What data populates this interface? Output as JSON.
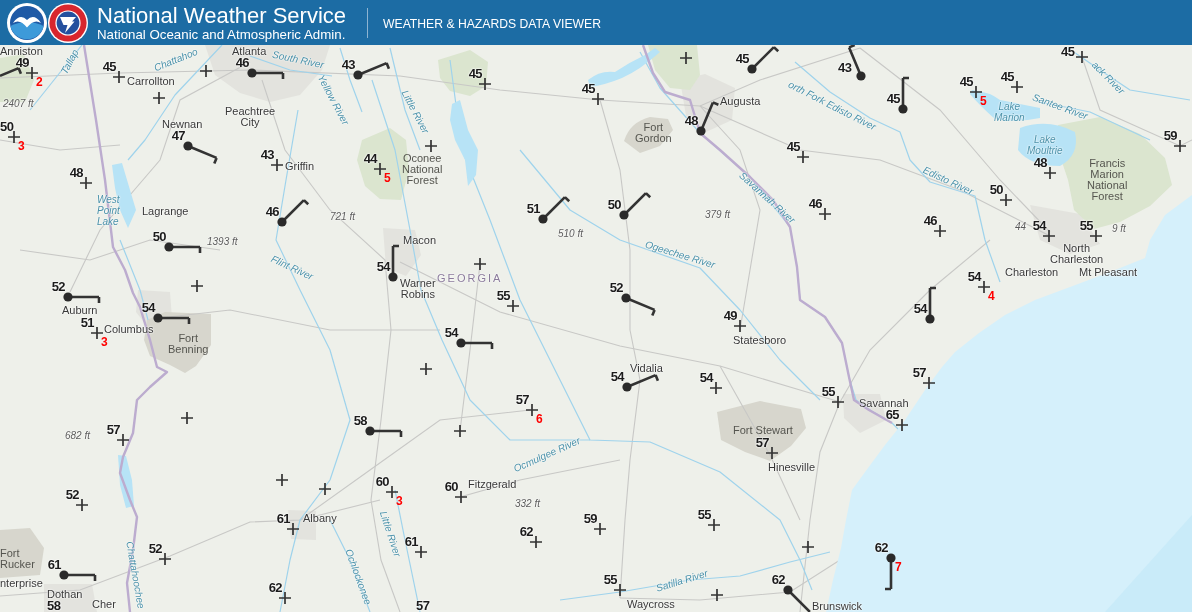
{
  "header": {
    "title": "National Weather Service",
    "subtitle": "National Oceanic and Atmospheric Admin.",
    "app_title": "WEATHER & HAZARDS DATA VIEWER"
  },
  "map": {
    "places": [
      {
        "text": "Anniston",
        "kind": "city"
      },
      {
        "text": "Tallap",
        "kind": "water"
      },
      {
        "text": "Chattahoo",
        "kind": "water"
      },
      {
        "text": "Atlanta",
        "kind": "city"
      },
      {
        "text": "South River",
        "kind": "water"
      },
      {
        "text": "Carrollton",
        "kind": "city"
      },
      {
        "text": "ack River",
        "kind": "water"
      },
      {
        "text": "2407 ft",
        "kind": "elevation"
      },
      {
        "text": "Yellow River",
        "kind": "water"
      },
      {
        "text": "Little River",
        "kind": "water"
      },
      {
        "text": "Augusta",
        "kind": "city"
      },
      {
        "text": "orth Fork Edisto River",
        "kind": "water"
      },
      {
        "text": "Lake Marion",
        "kind": "water"
      },
      {
        "text": "Santee River",
        "kind": "water"
      },
      {
        "text": "Newnan",
        "kind": "city"
      },
      {
        "text": "Peachtree City",
        "kind": "city"
      },
      {
        "text": "Fort Gordon",
        "kind": "area"
      },
      {
        "text": "Lake Moultrie",
        "kind": "water"
      },
      {
        "text": "Griffin",
        "kind": "city"
      },
      {
        "text": "Oconee National Forest",
        "kind": "area"
      },
      {
        "text": "Edisto River",
        "kind": "water"
      },
      {
        "text": "Francis Marion National Forest",
        "kind": "area"
      },
      {
        "text": "Savannah River",
        "kind": "water"
      },
      {
        "text": "West Point Lake",
        "kind": "water"
      },
      {
        "text": "Lagrange",
        "kind": "city"
      },
      {
        "text": "721 ft",
        "kind": "elevation"
      },
      {
        "text": "379 ft",
        "kind": "elevation"
      },
      {
        "text": "510 ft",
        "kind": "elevation"
      },
      {
        "text": "44",
        "kind": "elevation"
      },
      {
        "text": "9 ft",
        "kind": "elevation"
      },
      {
        "text": "1393 ft",
        "kind": "elevation"
      },
      {
        "text": "Macon",
        "kind": "city"
      },
      {
        "text": "Ogeechee River",
        "kind": "water"
      },
      {
        "text": "North Charleston",
        "kind": "city"
      },
      {
        "text": "Flint River",
        "kind": "water"
      },
      {
        "text": "GEORGIA",
        "kind": "state"
      },
      {
        "text": "Charleston",
        "kind": "city"
      },
      {
        "text": "Mt Pleasant",
        "kind": "city"
      },
      {
        "text": "Warner Robins",
        "kind": "city"
      },
      {
        "text": "Auburn",
        "kind": "city"
      },
      {
        "text": "Columbus",
        "kind": "city"
      },
      {
        "text": "Fort Benning",
        "kind": "area"
      },
      {
        "text": "Statesboro",
        "kind": "city"
      },
      {
        "text": "Vidalia",
        "kind": "city"
      },
      {
        "text": "Savannah",
        "kind": "city"
      },
      {
        "text": "682 ft",
        "kind": "elevation"
      },
      {
        "text": "Fort Stewart",
        "kind": "area"
      },
      {
        "text": "Ocmulgee River",
        "kind": "water"
      },
      {
        "text": "Hinesville",
        "kind": "city"
      },
      {
        "text": "Fitzgerald",
        "kind": "city"
      },
      {
        "text": "332 ft",
        "kind": "elevation"
      },
      {
        "text": "Albany",
        "kind": "city"
      },
      {
        "text": "Little River",
        "kind": "water"
      },
      {
        "text": "Fort Rucker",
        "kind": "area"
      },
      {
        "text": "nterprise",
        "kind": "city"
      },
      {
        "text": "Chattahoochee",
        "kind": "water"
      },
      {
        "text": "Ochlockonee",
        "kind": "water"
      },
      {
        "text": "Satilla River",
        "kind": "water"
      },
      {
        "text": "Dothan",
        "kind": "city"
      },
      {
        "text": "Cher",
        "kind": "city"
      },
      {
        "text": "Waycross",
        "kind": "city"
      },
      {
        "text": "Brunswick",
        "kind": "city"
      }
    ],
    "stations": [
      {
        "kind": "barb"
      },
      {
        "temperature": "49",
        "kind": "plus",
        "secondary_value": "2"
      },
      {
        "temperature": "45",
        "kind": "plus"
      },
      {
        "kind": "plus"
      },
      {
        "kind": "plus"
      },
      {
        "temperature": "46",
        "kind": "barb"
      },
      {
        "temperature": "43",
        "kind": "barb"
      },
      {
        "temperature": "45",
        "kind": "plus"
      },
      {
        "temperature": "45",
        "kind": "plus"
      },
      {
        "kind": "plus"
      },
      {
        "temperature": "45",
        "kind": "barb"
      },
      {
        "temperature": "43",
        "kind": "barb"
      },
      {
        "temperature": "45",
        "kind": "barb"
      },
      {
        "temperature": "45",
        "kind": "plus",
        "secondary_value": "5"
      },
      {
        "temperature": "45",
        "kind": "plus"
      },
      {
        "temperature": "45",
        "kind": "plus"
      },
      {
        "temperature": "50",
        "kind": "plus",
        "secondary_value": "3"
      },
      {
        "temperature": "48",
        "kind": "plus"
      },
      {
        "temperature": "47",
        "kind": "barb"
      },
      {
        "temperature": "43",
        "kind": "plus"
      },
      {
        "temperature": "44",
        "kind": "plus",
        "secondary_value": "5"
      },
      {
        "kind": "plus"
      },
      {
        "temperature": "48",
        "kind": "barb"
      },
      {
        "temperature": "45",
        "kind": "plus"
      },
      {
        "temperature": "48",
        "kind": "plus"
      },
      {
        "temperature": "59",
        "kind": "plus"
      },
      {
        "temperature": "50",
        "kind": "barb"
      },
      {
        "temperature": "46",
        "kind": "barb"
      },
      {
        "temperature": "51",
        "kind": "barb"
      },
      {
        "temperature": "50",
        "kind": "barb"
      },
      {
        "temperature": "46",
        "kind": "plus"
      },
      {
        "temperature": "46",
        "kind": "plus"
      },
      {
        "temperature": "50",
        "kind": "plus"
      },
      {
        "temperature": "54",
        "kind": "plus"
      },
      {
        "temperature": "55",
        "kind": "plus"
      },
      {
        "temperature": "52",
        "kind": "barb"
      },
      {
        "temperature": "51",
        "kind": "plus",
        "secondary_value": "3"
      },
      {
        "kind": "plus"
      },
      {
        "temperature": "54",
        "kind": "barb"
      },
      {
        "temperature": "54",
        "kind": "barb"
      },
      {
        "kind": "plus"
      },
      {
        "temperature": "54",
        "kind": "barb"
      },
      {
        "temperature": "55",
        "kind": "plus"
      },
      {
        "temperature": "52",
        "kind": "barb"
      },
      {
        "temperature": "49",
        "kind": "plus"
      },
      {
        "temperature": "54",
        "kind": "barb"
      },
      {
        "temperature": "54",
        "kind": "plus",
        "secondary_value": "4"
      },
      {
        "temperature": "57",
        "kind": "plus"
      },
      {
        "kind": "plus"
      },
      {
        "temperature": "58",
        "kind": "barb"
      },
      {
        "kind": "plus"
      },
      {
        "kind": "plus"
      },
      {
        "temperature": "57",
        "kind": "plus",
        "secondary_value": "6"
      },
      {
        "temperature": "54",
        "kind": "barb"
      },
      {
        "temperature": "54",
        "kind": "plus"
      },
      {
        "temperature": "57",
        "kind": "plus"
      },
      {
        "temperature": "55",
        "kind": "plus"
      },
      {
        "temperature": "65",
        "kind": "plus"
      },
      {
        "temperature": "57",
        "kind": "plus"
      },
      {
        "temperature": "52",
        "kind": "plus"
      },
      {
        "kind": "plus"
      },
      {
        "kind": "plus"
      },
      {
        "temperature": "60",
        "kind": "plus",
        "secondary_value": "3"
      },
      {
        "temperature": "60",
        "kind": "plus"
      },
      {
        "temperature": "61",
        "kind": "barb"
      },
      {
        "temperature": "58"
      },
      {
        "temperature": "52",
        "kind": "plus"
      },
      {
        "temperature": "61",
        "kind": "plus"
      },
      {
        "temperature": "62",
        "kind": "plus"
      },
      {
        "temperature": "61",
        "kind": "plus"
      },
      {
        "temperature": "57"
      },
      {
        "temperature": "62",
        "kind": "plus"
      },
      {
        "temperature": "59",
        "kind": "plus"
      },
      {
        "temperature": "55",
        "kind": "plus"
      },
      {
        "temperature": "55",
        "kind": "plus"
      },
      {
        "kind": "plus"
      },
      {
        "kind": "plus"
      },
      {
        "temperature": "62",
        "kind": "barb"
      },
      {
        "temperature": "62",
        "kind": "barb",
        "secondary_value": "7"
      }
    ]
  }
}
